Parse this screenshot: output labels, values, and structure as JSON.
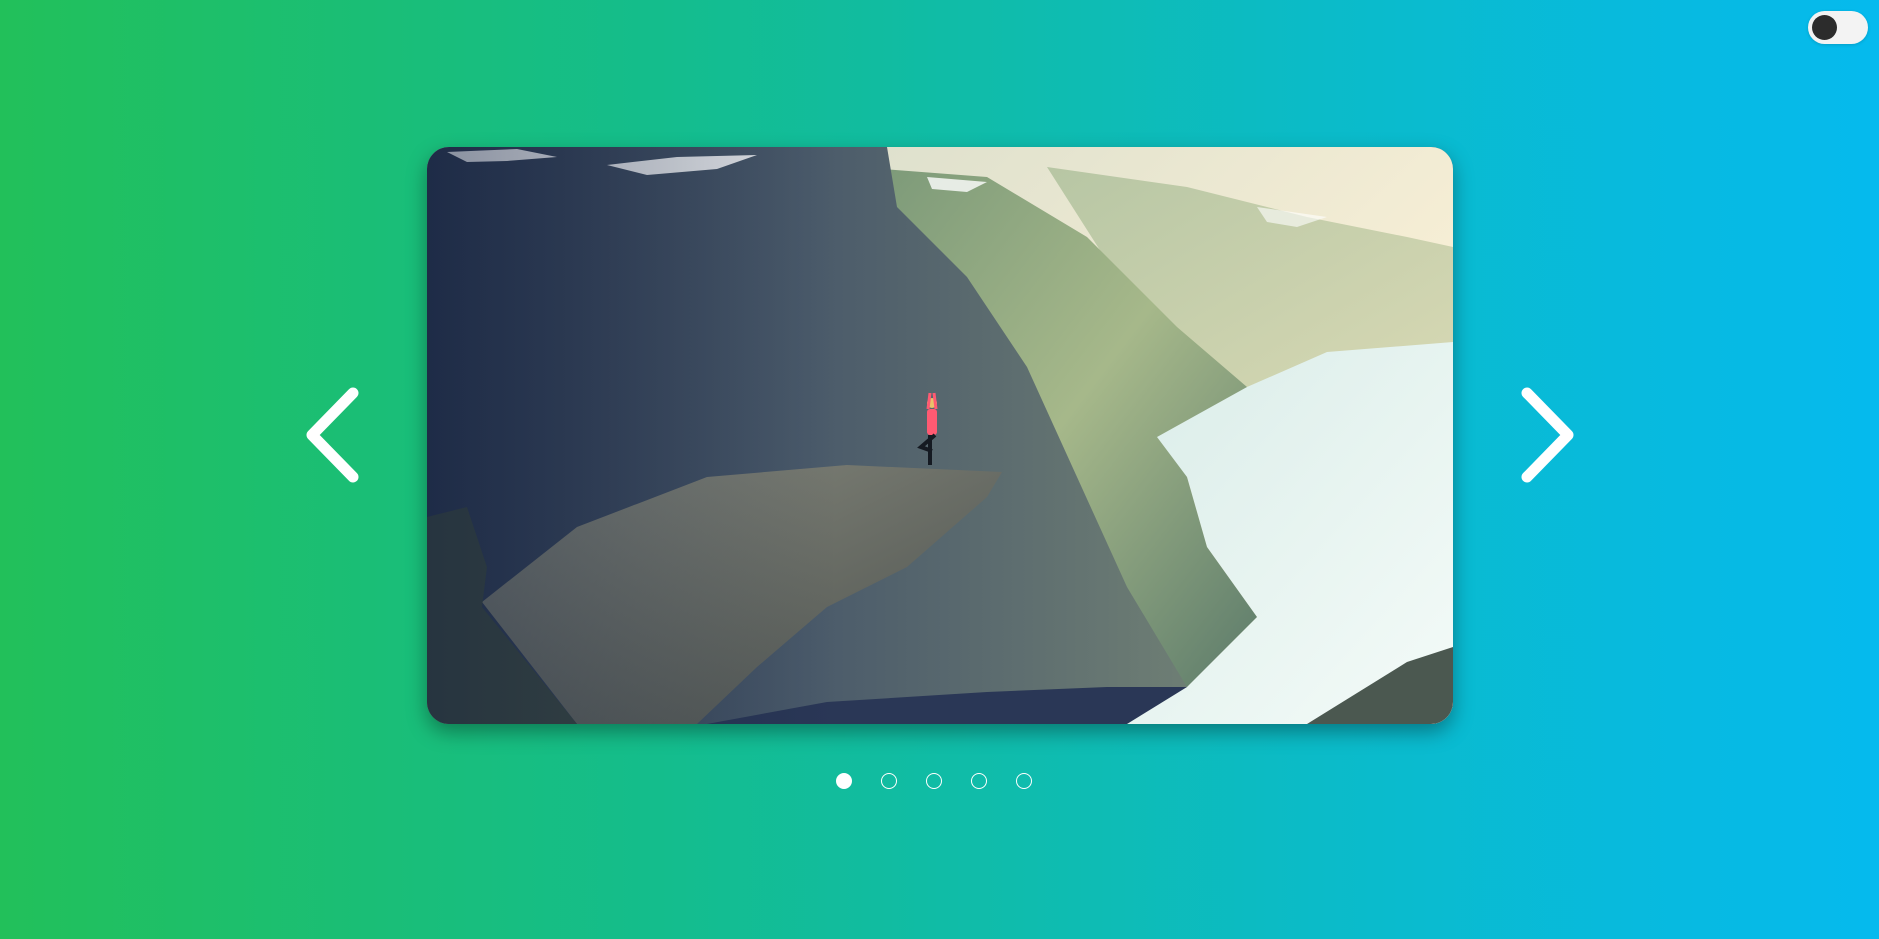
{
  "toggle": {
    "icon": "theme-toggle-switch",
    "state": "off",
    "knob_color": "#2c2c2c",
    "track_color": "#f3f3f3"
  },
  "slider": {
    "current_index": 0,
    "total_slides": 5,
    "slides": [
      {
        "image": "person-yoga-pose-on-cliff-ledge-above-fjord"
      }
    ],
    "prev_icon": "chevron-left-icon",
    "next_icon": "chevron-right-icon",
    "dots": [
      {
        "active": true
      },
      {
        "active": false
      },
      {
        "active": false
      },
      {
        "active": false
      },
      {
        "active": false
      }
    ]
  },
  "colors": {
    "background_start": "#22c05a",
    "background_end": "#05baee",
    "arrow": "#ffffff",
    "dot": "#ffffff"
  }
}
